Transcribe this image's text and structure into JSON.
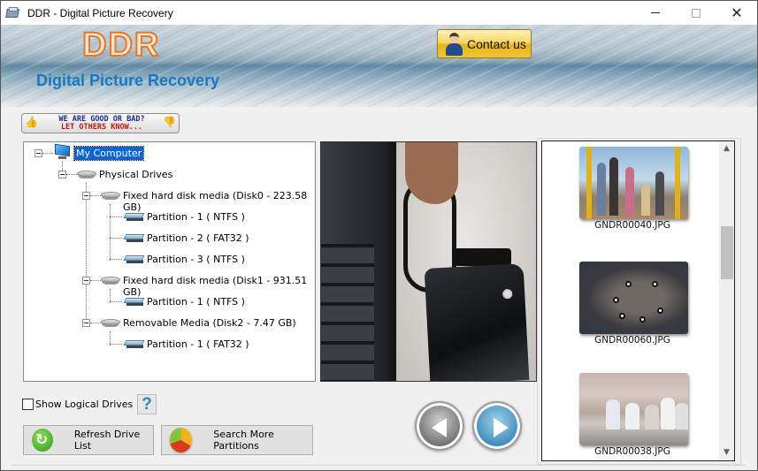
{
  "window": {
    "title": "DDR - Digital Picture Recovery",
    "controls": {
      "minimize": "minimize",
      "maximize": "maximize",
      "close": "close"
    }
  },
  "banner": {
    "logo": "DDR",
    "subtitle": "Digital Picture Recovery",
    "contact_label": "Contact us"
  },
  "feedback": {
    "line1": "WE ARE GOOD OR BAD?",
    "line2": "LET OTHERS KNOW..."
  },
  "tree": {
    "root": "My Computer",
    "physical": "Physical Drives",
    "disks": [
      {
        "label": "Fixed hard disk media (Disk0 - 223.58 GB)",
        "partitions": [
          "Partition - 1 ( NTFS )",
          "Partition - 2 ( FAT32 )",
          "Partition - 3 ( NTFS )"
        ]
      },
      {
        "label": "Fixed hard disk media (Disk1 - 931.51 GB)",
        "partitions": [
          "Partition - 1 ( NTFS )"
        ]
      },
      {
        "label": "Removable Media (Disk2 - 7.47 GB)",
        "partitions": [
          "Partition - 1 ( FAT32 )"
        ]
      }
    ]
  },
  "thumbnails": [
    {
      "filename": "GNDR00040.JPG"
    },
    {
      "filename": "GNDR00060.JPG"
    },
    {
      "filename": "GNDR00038.JPG"
    }
  ],
  "controls": {
    "show_logical_label": "Show Logical Drives",
    "show_logical_checked": false,
    "help_label": "?",
    "refresh_label": "Refresh Drive List",
    "search_label": "Search More Partitions"
  }
}
